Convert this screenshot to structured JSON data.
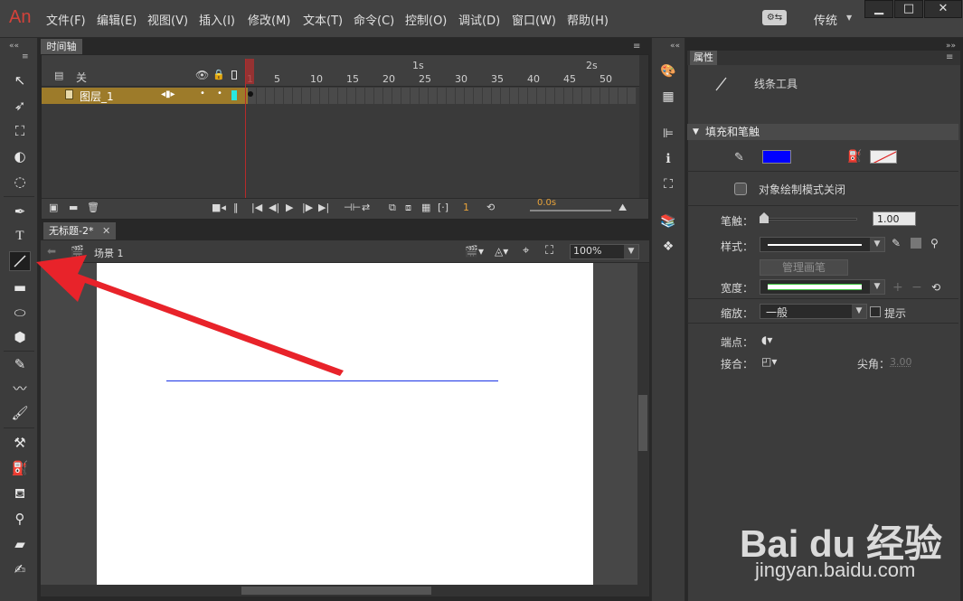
{
  "app": {
    "logo": "An"
  },
  "menu": [
    "文件(F)",
    "编辑(E)",
    "视图(V)",
    "插入(I)",
    "修改(M)",
    "文本(T)",
    "命令(C)",
    "控制(O)",
    "调试(D)",
    "窗口(W)",
    "帮助(H)"
  ],
  "workspace": {
    "label": "传统"
  },
  "window_controls": {
    "minimize": "▁",
    "maximize": "□",
    "close": "✕"
  },
  "timeline": {
    "tab_label": "时间轴",
    "header_layer": "关",
    "layer_name": "图层_1",
    "seconds": [
      "1s",
      "2s"
    ],
    "frame_ticks": [
      "1",
      "5",
      "10",
      "15",
      "20",
      "25",
      "30",
      "35",
      "40",
      "45",
      "50"
    ],
    "current_frame": "1",
    "frame_rate": "0.0s"
  },
  "document": {
    "tab_label": "无标题-2*",
    "scene_label": "场景 1",
    "zoom": "100%"
  },
  "properties": {
    "tab_label": "属性",
    "tool_name": "线条工具",
    "section_fill_stroke": "填充和笔触",
    "stroke_color": "#0000ff",
    "object_draw_mode": "对象绘制模式关闭",
    "stroke_label": "笔触：",
    "stroke_value": "1.00",
    "style_label": "样式：",
    "manage_brush": "管理画笔",
    "width_label": "宽度：",
    "scale_label": "缩放：",
    "scale_value": "一般",
    "hint_label": "提示",
    "cap_label": "端点：",
    "join_label": "接合：",
    "miter_label": "尖角：",
    "miter_value": "3.00"
  },
  "watermark": {
    "logo": "Bai du 经验",
    "url": "jingyan.baidu.com"
  }
}
